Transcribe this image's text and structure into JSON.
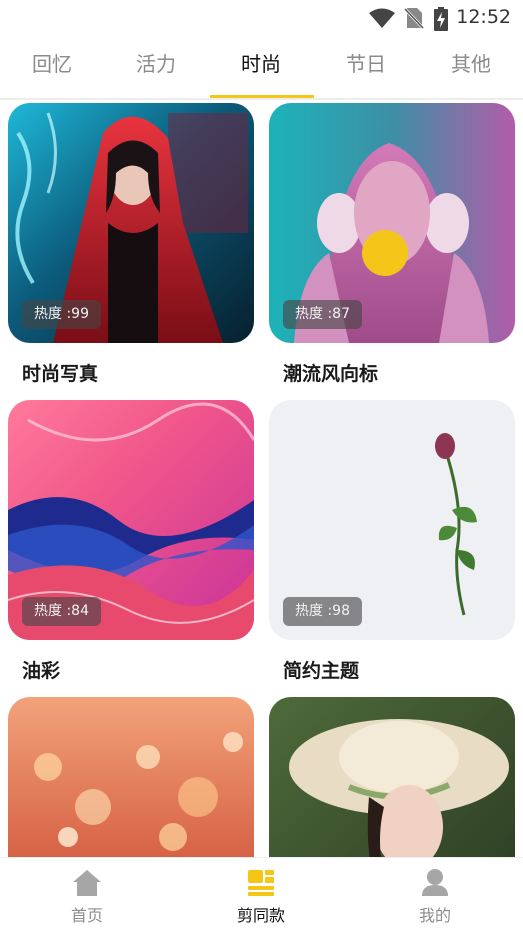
{
  "status_bar": {
    "time": "12:52",
    "icons": [
      "wifi-icon",
      "no-sim-icon",
      "battery-charging-icon"
    ]
  },
  "tabs": [
    {
      "label": "回忆",
      "active": false
    },
    {
      "label": "活力",
      "active": false
    },
    {
      "label": "时尚",
      "active": true
    },
    {
      "label": "节日",
      "active": false
    },
    {
      "label": "其他",
      "active": false
    }
  ],
  "cards": [
    {
      "title": "时尚写真",
      "heat": "热度 :99"
    },
    {
      "title": "潮流风向标",
      "heat": "热度 :87"
    },
    {
      "title": "油彩",
      "heat": "热度 :84"
    },
    {
      "title": "简约主题",
      "heat": "热度 :98"
    },
    {
      "title": "",
      "heat": ""
    },
    {
      "title": "",
      "heat": ""
    }
  ],
  "bottom_nav": [
    {
      "label": "首页",
      "icon": "home-icon",
      "active": false
    },
    {
      "label": "剪同款",
      "icon": "template-icon",
      "active": true
    },
    {
      "label": "我的",
      "icon": "profile-icon",
      "active": false
    }
  ],
  "colors": {
    "accent": "#f5c518",
    "active_text": "#111111",
    "inactive_text": "#8a8a8a"
  }
}
